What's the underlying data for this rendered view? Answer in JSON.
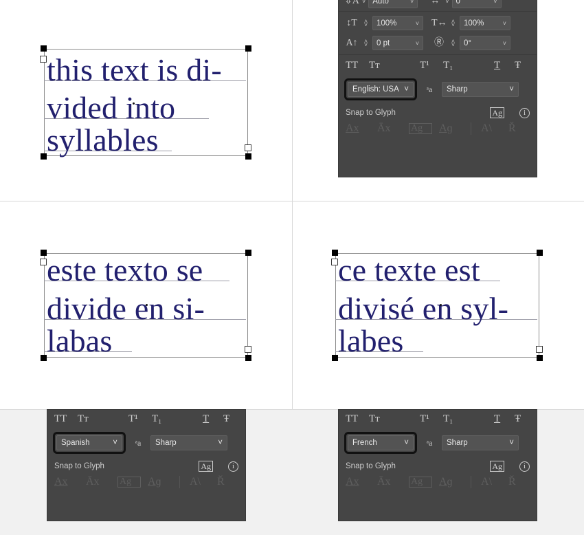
{
  "quadrants": {
    "english": {
      "artwork_lines": [
        "this text is di-",
        "vided into",
        "syllables"
      ],
      "panel": {
        "cut_row": {
          "leading_value": "Auto",
          "tracking_value": "0"
        },
        "vertical_scale": {
          "icon": "vertical-scale-icon",
          "value": "100%"
        },
        "horizontal_scale": {
          "icon": "horizontal-scale-icon",
          "value": "100%"
        },
        "baseline_shift": {
          "icon": "baseline-shift-icon",
          "value": "0 pt"
        },
        "character_rotation": {
          "icon": "character-rotation-icon",
          "value": "0°"
        },
        "styles": [
          "TT",
          "Tт",
          "T¹",
          "T₁",
          "T",
          "Ŧ"
        ],
        "style_names": [
          "all-caps",
          "small-caps",
          "superscript",
          "subscript",
          "underline",
          "strikethrough"
        ],
        "language": "English: USA",
        "antialias_icon": "aa-icon",
        "antialias": "Sharp",
        "snap_label": "Snap to Glyph",
        "snap_ag": "Ag",
        "info": "i",
        "glyph_buttons": [
          "Ax",
          "Āx",
          "Ag",
          "Aɡ",
          "A\\",
          "Ř"
        ],
        "glyph_button_names": [
          "snap-x-height",
          "snap-cap-height",
          "snap-em-box",
          "snap-baseline",
          "snap-angle",
          "snap-stem"
        ]
      }
    },
    "spanish": {
      "artwork_lines": [
        "este texto se",
        "divide en si-",
        "labas"
      ],
      "panel": {
        "styles": [
          "TT",
          "Tт",
          "T¹",
          "T₁",
          "T",
          "Ŧ"
        ],
        "style_names": [
          "all-caps",
          "small-caps",
          "superscript",
          "subscript",
          "underline",
          "strikethrough"
        ],
        "language": "Spanish",
        "antialias_icon": "aa-icon",
        "antialias": "Sharp",
        "snap_label": "Snap to Glyph",
        "snap_ag": "Ag",
        "info": "i",
        "glyph_buttons": [
          "Ax",
          "Āx",
          "Ag",
          "Aɡ",
          "A\\",
          "Ř"
        ],
        "glyph_button_names": [
          "snap-x-height",
          "snap-cap-height",
          "snap-em-box",
          "snap-baseline",
          "snap-angle",
          "snap-stem"
        ]
      }
    },
    "french": {
      "artwork_lines": [
        "ce texte est",
        "divisé en syl-",
        "labes"
      ],
      "panel": {
        "styles": [
          "TT",
          "Tт",
          "T¹",
          "T₁",
          "T",
          "Ŧ"
        ],
        "style_names": [
          "all-caps",
          "small-caps",
          "superscript",
          "subscript",
          "underline",
          "strikethrough"
        ],
        "language": "French",
        "antialias_icon": "aa-icon",
        "antialias": "Sharp",
        "snap_label": "Snap to Glyph",
        "snap_ag": "Ag",
        "info": "i",
        "glyph_buttons": [
          "Ax",
          "Āx",
          "Ag",
          "Aɡ",
          "A\\",
          "Ř"
        ],
        "glyph_button_names": [
          "snap-x-height",
          "snap-cap-height",
          "snap-em-box",
          "snap-baseline",
          "snap-angle",
          "snap-stem"
        ]
      }
    }
  },
  "colors": {
    "text_color": "#22206e",
    "panel_bg": "#454545",
    "field_bg": "#535353",
    "highlight_ring": "#111111"
  }
}
